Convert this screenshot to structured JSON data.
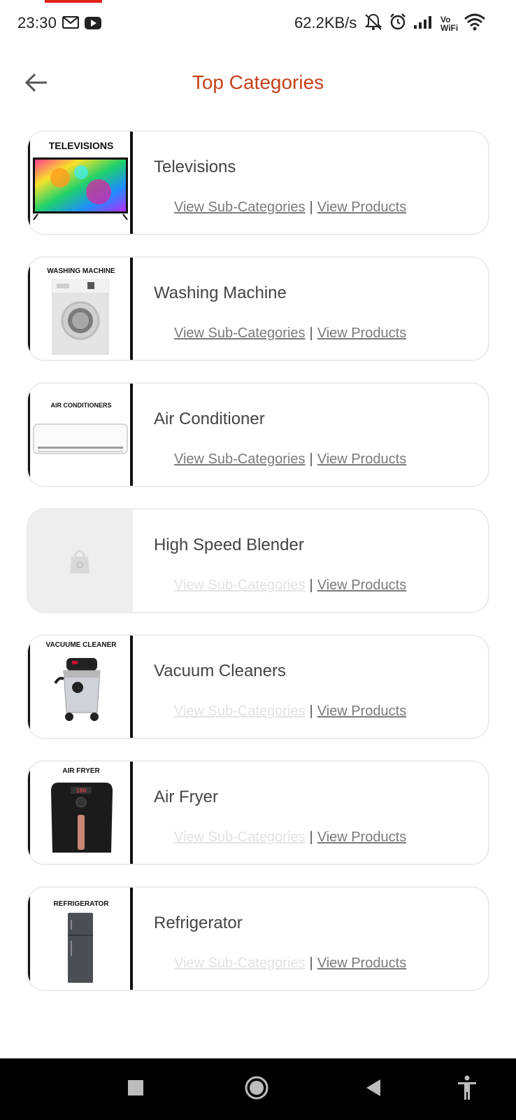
{
  "status_bar": {
    "time": "23:30",
    "network_speed": "62.2KB/s",
    "vowifi_top": "Vo",
    "vowifi_bottom": "WiFi",
    "icons": [
      "gmail-icon",
      "youtube-icon",
      "notifications-muted-icon",
      "alarm-icon",
      "signal-icon",
      "vowifi-icon",
      "wifi-icon"
    ]
  },
  "header": {
    "title": "Top Categories",
    "back_icon": "arrow-left-icon"
  },
  "categories": [
    {
      "name": "Televisions",
      "thumb_label": "TELEVISIONS",
      "sub_link": "View Sub-Categories",
      "products_link": "View Products",
      "sub_enabled": true
    },
    {
      "name": "Washing Machine",
      "thumb_label": "WASHING MACHINE",
      "sub_link": "View Sub-Categories",
      "products_link": "View Products",
      "sub_enabled": true
    },
    {
      "name": "Air Conditioner",
      "thumb_label": "AIR CONDITIONERS",
      "sub_link": "View Sub-Categories",
      "products_link": "View Products",
      "sub_enabled": true
    },
    {
      "name": "High Speed Blender",
      "thumb_label": "",
      "sub_link": "View Sub-Categories",
      "products_link": "View Products",
      "sub_enabled": false
    },
    {
      "name": "Vacuum Cleaners",
      "thumb_label": "VACUUME CLEANER",
      "sub_link": "View Sub-Categories",
      "products_link": "View Products",
      "sub_enabled": false
    },
    {
      "name": "Air Fryer",
      "thumb_label": "AIR FRYER",
      "sub_link": "View Sub-Categories",
      "products_link": "View Products",
      "sub_enabled": false
    },
    {
      "name": "Refrigerator",
      "thumb_label": "REFRIGERATOR",
      "sub_link": "View Sub-Categories",
      "products_link": "View Products",
      "sub_enabled": false
    }
  ],
  "separator": "|",
  "nav_bar": {
    "buttons": [
      "recents-square-icon",
      "home-circle-icon",
      "back-triangle-icon",
      "accessibility-icon"
    ]
  },
  "colors": {
    "title": "#c5401a",
    "recording_strip": "#e2231a",
    "link": "#7a7a7a",
    "link_disabled": "#e2e2e2"
  }
}
